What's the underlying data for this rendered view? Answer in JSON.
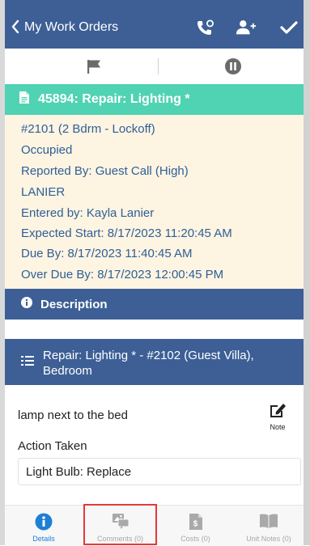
{
  "header": {
    "back_label": "My Work Orders",
    "icons": [
      "phone-refresh-icon",
      "add-user-icon",
      "checkmark-icon"
    ]
  },
  "actions_bar": {
    "icons": [
      "flag-icon",
      "pause-icon"
    ]
  },
  "work_order": {
    "title": "45894: Repair: Lighting *",
    "details": [
      "#2101 (2 Bdrm - Lockoff)",
      "Occupied",
      "Reported By: Guest Call  (High)",
      "LANIER",
      "Entered by: Kayla Lanier",
      "Expected Start: 8/17/2023 11:20:45 AM",
      "Due By: 8/17/2023 11:40:45 AM",
      "Over Due By: 8/17/2023 12:00:45 PM"
    ]
  },
  "description": {
    "label": "Description"
  },
  "task": {
    "title": "Repair: Lighting * - #2102 (Guest Villa), Bedroom",
    "notes": "lamp next to the bed",
    "note_button_label": "Note",
    "action_taken_label": "Action Taken",
    "action_taken_value": "Light Bulb: Replace"
  },
  "tabs": [
    {
      "label": "Details",
      "icon": "info-icon",
      "active": true
    },
    {
      "label": "Comments (0)",
      "icon": "comments-icon",
      "active": false
    },
    {
      "label": "Costs (0)",
      "icon": "costs-icon",
      "active": false
    },
    {
      "label": "Unit Notes (0)",
      "icon": "book-icon",
      "active": false
    }
  ],
  "colors": {
    "header_blue": "#3d5f96",
    "teal": "#4fd3b3",
    "info_bg": "#fdf4e2",
    "info_text": "#2f5f96",
    "active_tab": "#1d7fd6",
    "highlight": "#e23a3a"
  }
}
